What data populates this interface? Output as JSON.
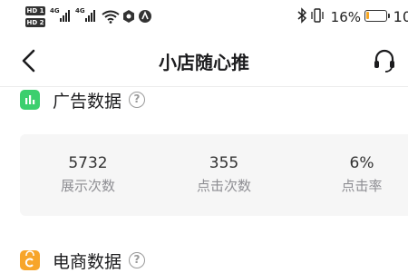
{
  "status_bar": {
    "sim1": "HD 1",
    "sim2": "HD 2",
    "net1": "4G",
    "net2": "4G",
    "battery_percent": "16%",
    "battery_level": 0.16,
    "time_partial": "10",
    "battery_color": "#f5a623"
  },
  "nav": {
    "title": "小店随心推"
  },
  "ad_data": {
    "title": "广告数据",
    "help": "?",
    "icon_color": "#3ccf6e",
    "stats": [
      {
        "value": "5732",
        "label": "展示次数"
      },
      {
        "value": "355",
        "label": "点击次数"
      },
      {
        "value": "6%",
        "label": "点击率"
      }
    ]
  },
  "ecommerce_data": {
    "title": "电商数据",
    "help": "?",
    "icon_color": "#f7a52a"
  }
}
